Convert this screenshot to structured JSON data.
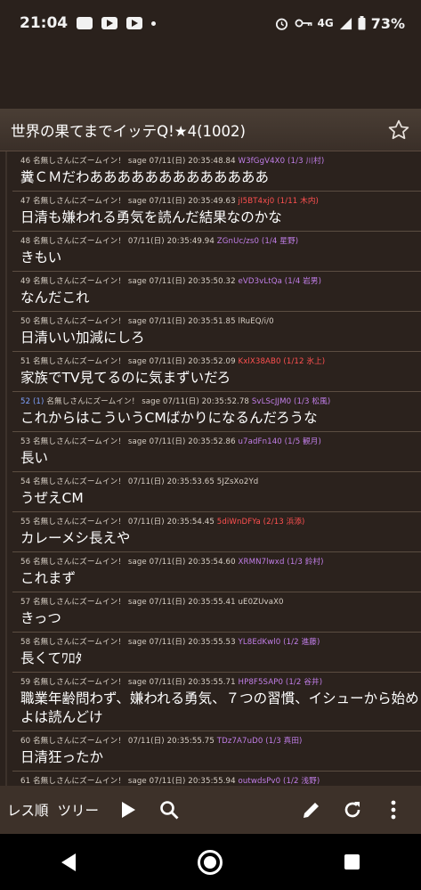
{
  "status_bar": {
    "time": "21:04",
    "network": "4G",
    "battery": "73%"
  },
  "thread": {
    "title": "世界の果てまでイッテQ!★4(1002)"
  },
  "posts": [
    {
      "meta_num": "46",
      "meta_rest": "名無しさんにズームイン！ sage 07/11(日) 20:35:48.84",
      "id": "W3fGgV4X0 (1/3 川村)",
      "id_color": "purple",
      "body": "糞ＣＭだわあああああああああああああ"
    },
    {
      "meta_num": "47",
      "meta_rest": "名無しさんにズームイン！ sage 07/11(日) 20:35:49.63",
      "id": "jI5BT4xj0 (1/11 木内)",
      "id_color": "red",
      "body": "日清も嫌われる勇気を読んだ結果なのかな"
    },
    {
      "meta_num": "48",
      "meta_rest": "名無しさんにズームイン！ 07/11(日) 20:35:49.94",
      "id": "ZGnUc/zs0 (1/4 星野)",
      "id_color": "purple",
      "body": "きもい"
    },
    {
      "meta_num": "49",
      "meta_rest": "名無しさんにズームイン！ sage 07/11(日) 20:35:50.32",
      "id": "eVD3vLtQa (1/4 岩男)",
      "id_color": "purple",
      "body": "なんだこれ"
    },
    {
      "meta_num": "50",
      "meta_rest": "名無しさんにズームイン！ sage 07/11(日) 20:35:51.85 lRuEQ/i/0",
      "id": "",
      "id_color": "",
      "body": "日清いい加減にしろ"
    },
    {
      "meta_num": "51",
      "meta_rest": "名無しさんにズームイン！ sage 07/11(日) 20:35:52.09",
      "id": "KxlX38AB0 (1/12 氷上)",
      "id_color": "red",
      "body": "家族でTV見てるのに気まずいだろ"
    },
    {
      "meta_num": "52 (1)",
      "meta_rest": "名無しさんにズームイン！ sage 07/11(日) 20:35:52.78",
      "id": "SvLScJJM0 (1/3 松風)",
      "id_color": "purple",
      "linked": true,
      "body": "これからはこういうCMばかりになるんだろうな"
    },
    {
      "meta_num": "53",
      "meta_rest": "名無しさんにズームイン！ sage 07/11(日) 20:35:52.86",
      "id": "u7adFn140 (1/5 観月)",
      "id_color": "purple",
      "body": "長い"
    },
    {
      "meta_num": "54",
      "meta_rest": "名無しさんにズームイン！ 07/11(日) 20:35:53.65 5JZsXo2Yd",
      "id": "",
      "id_color": "",
      "body": "うぜえCM"
    },
    {
      "meta_num": "55",
      "meta_rest": "名無しさんにズームイン！ 07/11(日) 20:35:54.45",
      "id": "5diWnDFYa (2/13 浜添)",
      "id_color": "red",
      "body": "カレーメシ長えや"
    },
    {
      "meta_num": "56",
      "meta_rest": "名無しさんにズームイン！ sage 07/11(日) 20:35:54.60",
      "id": "XRMN7lwxd (1/3 鈴村)",
      "id_color": "purple",
      "body": "これまず"
    },
    {
      "meta_num": "57",
      "meta_rest": "名無しさんにズームイン！ sage 07/11(日) 20:35:55.41 uE0ZUvaX0",
      "id": "",
      "id_color": "",
      "body": "きっつ"
    },
    {
      "meta_num": "58",
      "meta_rest": "名無しさんにズームイン！ sage 07/11(日) 20:35:55.53",
      "id": "YL8EdKwl0 (1/2 進藤)",
      "id_color": "purple",
      "body": "長くてﾜﾛﾀ"
    },
    {
      "meta_num": "59",
      "meta_rest": "名無しさんにズームイン！ sage 07/11(日) 20:35:55.71",
      "id": "HP8F5SAP0 (1/2 谷井)",
      "id_color": "purple",
      "body": "職業年齢問わず、嫌われる勇気、７つの習慣、イシューから始めよは読んどけ",
      "tall": true
    },
    {
      "meta_num": "60",
      "meta_rest": "名無しさんにズームイン！ 07/11(日) 20:35:55.75",
      "id": "TDz7A7uD0 (1/3 真田)",
      "id_color": "purple",
      "body": "日清狂ったか"
    },
    {
      "meta_num": "61",
      "meta_rest": "名無しさんにズームイン！ sage 07/11(日) 20:35:55.94",
      "id": "outwdsPv0 (1/2 浅野)",
      "id_color": "purple",
      "body": ""
    }
  ],
  "toolbar": {
    "tab_res_order": "レス順",
    "tab_tree": "ツリー"
  },
  "icons": {
    "star": "star-outline-icon",
    "play": "play-icon",
    "search": "search-icon",
    "edit": "pencil-icon",
    "refresh": "refresh-icon",
    "more": "more-vert-icon"
  },
  "colors": {
    "background": "#2b221d",
    "titlebar": "#3f342c",
    "purple_id": "#c17ee8",
    "red_id": "#ff5050",
    "link_num": "#7fa2ff"
  }
}
